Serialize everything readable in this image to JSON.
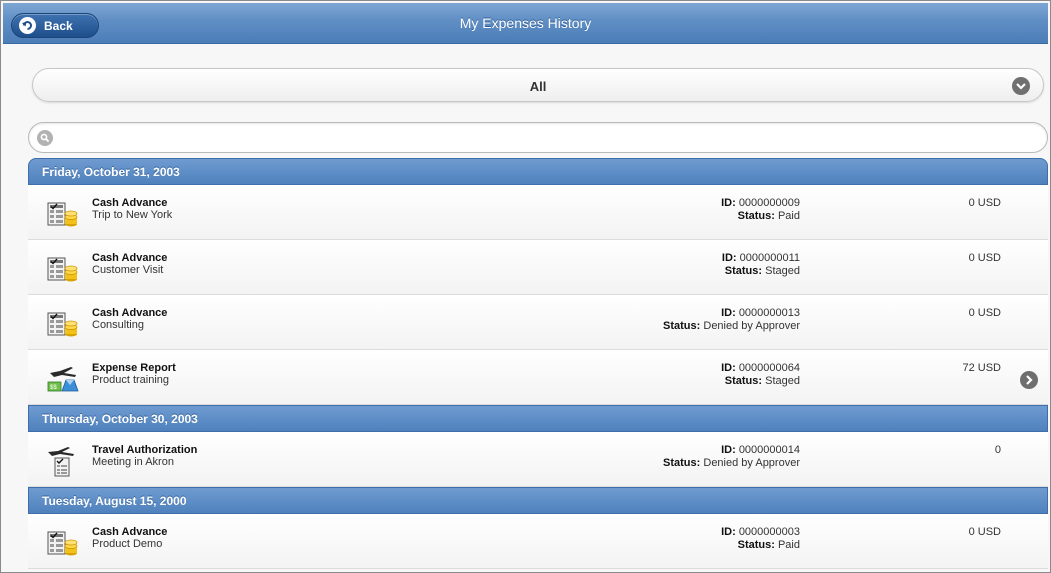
{
  "header": {
    "title": "My Expenses History",
    "back_label": "Back"
  },
  "filter": {
    "selected": "All"
  },
  "search": {
    "placeholder": "",
    "value": ""
  },
  "groups": [
    {
      "date": "Friday, October 31, 2003",
      "items": [
        {
          "type": "Cash Advance",
          "icon": "cash-advance-icon",
          "desc": "Trip to New York",
          "id_label": "ID:",
          "id": "0000000009",
          "status_label": "Status:",
          "status": "Paid",
          "amount": "0 USD"
        },
        {
          "type": "Cash Advance",
          "icon": "cash-advance-icon",
          "desc": "Customer Visit",
          "id_label": "ID:",
          "id": "0000000011",
          "status_label": "Status:",
          "status": "Staged",
          "amount": "0 USD"
        },
        {
          "type": "Cash Advance",
          "icon": "cash-advance-icon",
          "desc": "Consulting",
          "id_label": "ID:",
          "id": "0000000013",
          "status_label": "Status:",
          "status": "Denied by Approver",
          "amount": "0 USD"
        },
        {
          "type": "Expense Report",
          "icon": "expense-report-icon",
          "desc": "Product training",
          "id_label": "ID:",
          "id": "0000000064",
          "status_label": "Status:",
          "status": "Staged",
          "amount": "72 USD",
          "has_arrow": true
        }
      ]
    },
    {
      "date": "Thursday, October 30, 2003",
      "items": [
        {
          "type": "Travel Authorization",
          "icon": "travel-authorization-icon",
          "desc": "Meeting in Akron",
          "id_label": "ID:",
          "id": "0000000014",
          "status_label": "Status:",
          "status": "Denied by Approver",
          "amount": "0"
        }
      ]
    },
    {
      "date": "Tuesday, August 15, 2000",
      "items": [
        {
          "type": "Cash Advance",
          "icon": "cash-advance-icon",
          "desc": "Product Demo",
          "id_label": "ID:",
          "id": "0000000003",
          "status_label": "Status:",
          "status": "Paid",
          "amount": "0 USD"
        }
      ]
    }
  ],
  "colors": {
    "header": "#5f8ec4",
    "divider": "#4f81bd",
    "back_button": "#2a5d9c"
  }
}
